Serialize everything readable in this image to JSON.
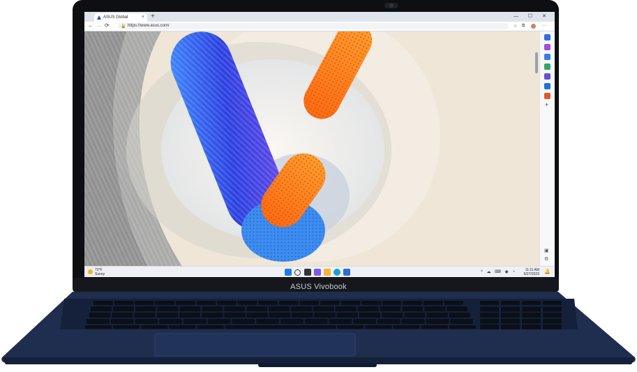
{
  "device": {
    "brand_label": "ASUS Vivobook"
  },
  "browser": {
    "tab_title": "ASUS Global",
    "tab_close": "×",
    "new_tab": "+",
    "window_controls": "— ☐ ✕",
    "url": "https://www.asus.com/",
    "back": "←",
    "forward": "→",
    "refresh": "⟳",
    "home": "⌂",
    "more": "···"
  },
  "taskbar": {
    "weather_temp": "72°F",
    "weather_desc": "Sunny",
    "time": "11:11 AM",
    "date": "6/27/2023",
    "tray": "^ ☁ ⌨ ◉ ◔"
  },
  "colors": {
    "body_navy": "#1d2c48",
    "accent_orange": "#ff8a1a",
    "accent_blue": "#2c48e0"
  }
}
